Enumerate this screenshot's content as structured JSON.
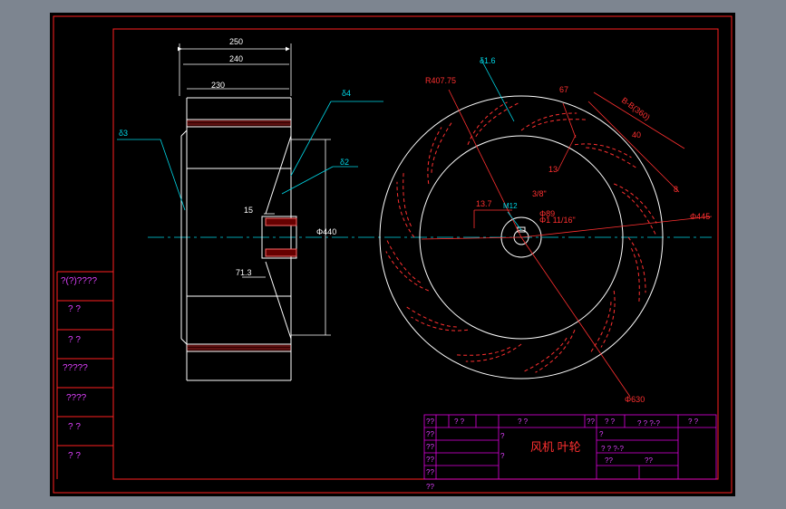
{
  "colors": {
    "background": "#7d8590",
    "sheet": "#000000",
    "frame": "#ff2020",
    "outline": "#ffffff",
    "centerline": "#00d8e8",
    "leader": "#00d8e8",
    "title_grid": "#e000e0",
    "title_text": "#ff3030"
  },
  "side_view": {
    "dimensions": {
      "width_overall": "250",
      "width_middle": "240",
      "width_inner": "230",
      "shroud_thickness": "δ4",
      "blade_thickness": "δ2",
      "backplate_thickness": "δ3",
      "inlet_diameter": "Φ440",
      "hub_length": "15",
      "hub_offset": "71.3"
    }
  },
  "front_view": {
    "dimensions": {
      "blade_thickness": "δ1.6",
      "blade_arc_radius": "R407.75",
      "blade_spacing": "67",
      "blade_length": "40",
      "blade_tip": "8",
      "blade_chord": "13",
      "inlet_diameter": "Φ445",
      "outer_diameter": "Φ630",
      "hub_diameter": "Φ89",
      "bore_thread": "Φ1 11/16\"",
      "keyway_depth": "13.7",
      "keyway_label": "M12",
      "thread_label": "3/8\"",
      "section_note": "B-B(360)"
    }
  },
  "side_table": {
    "rows": [
      "?(?)????",
      "?  ?",
      "?  ?",
      "?????",
      "????",
      "?  ?",
      "?  ?"
    ]
  },
  "title_block": {
    "title": "风机 叶轮",
    "cells": [
      "??",
      "?  ?",
      "?  ?",
      "??",
      "?  ?",
      "? ? ?-?",
      "?  ?",
      "??",
      "??",
      "??",
      "??",
      "??",
      "?",
      "?",
      "?",
      "? ? ?-?",
      "??",
      "??"
    ]
  }
}
